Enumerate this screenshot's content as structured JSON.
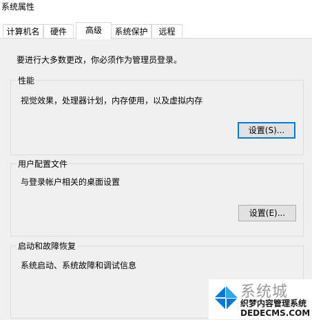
{
  "window": {
    "title": "系统属性"
  },
  "tabs": [
    {
      "label": "计算机名",
      "active": false
    },
    {
      "label": "硬件",
      "active": false
    },
    {
      "label": "高级",
      "active": true
    },
    {
      "label": "系统保护",
      "active": false
    },
    {
      "label": "远程",
      "active": false
    }
  ],
  "advanced": {
    "admin_note": "要进行大多数更改，你必须作为管理员登录。",
    "performance": {
      "title": "性能",
      "description": "视觉效果，处理器计划，内存使用，以及虚拟内存",
      "button": "设置(S)..."
    },
    "user_profiles": {
      "title": "用户配置文件",
      "description": "与登录帐户相关的桌面设置",
      "button": "设置(E)..."
    },
    "startup_recovery": {
      "title": "启动和故障恢复",
      "description": "系统启动、系统故障和调试信息"
    }
  },
  "watermark": {
    "site_name": "系统城",
    "caption": "织梦内容管理系统",
    "url": "DEDECMS.COM",
    "colors": {
      "primary": "#0078d7",
      "secondary": "#2ea8e5"
    }
  },
  "colors": {
    "accent": "#0078d7",
    "panel": "#f0f0f0",
    "border": "#dcdcdc"
  }
}
